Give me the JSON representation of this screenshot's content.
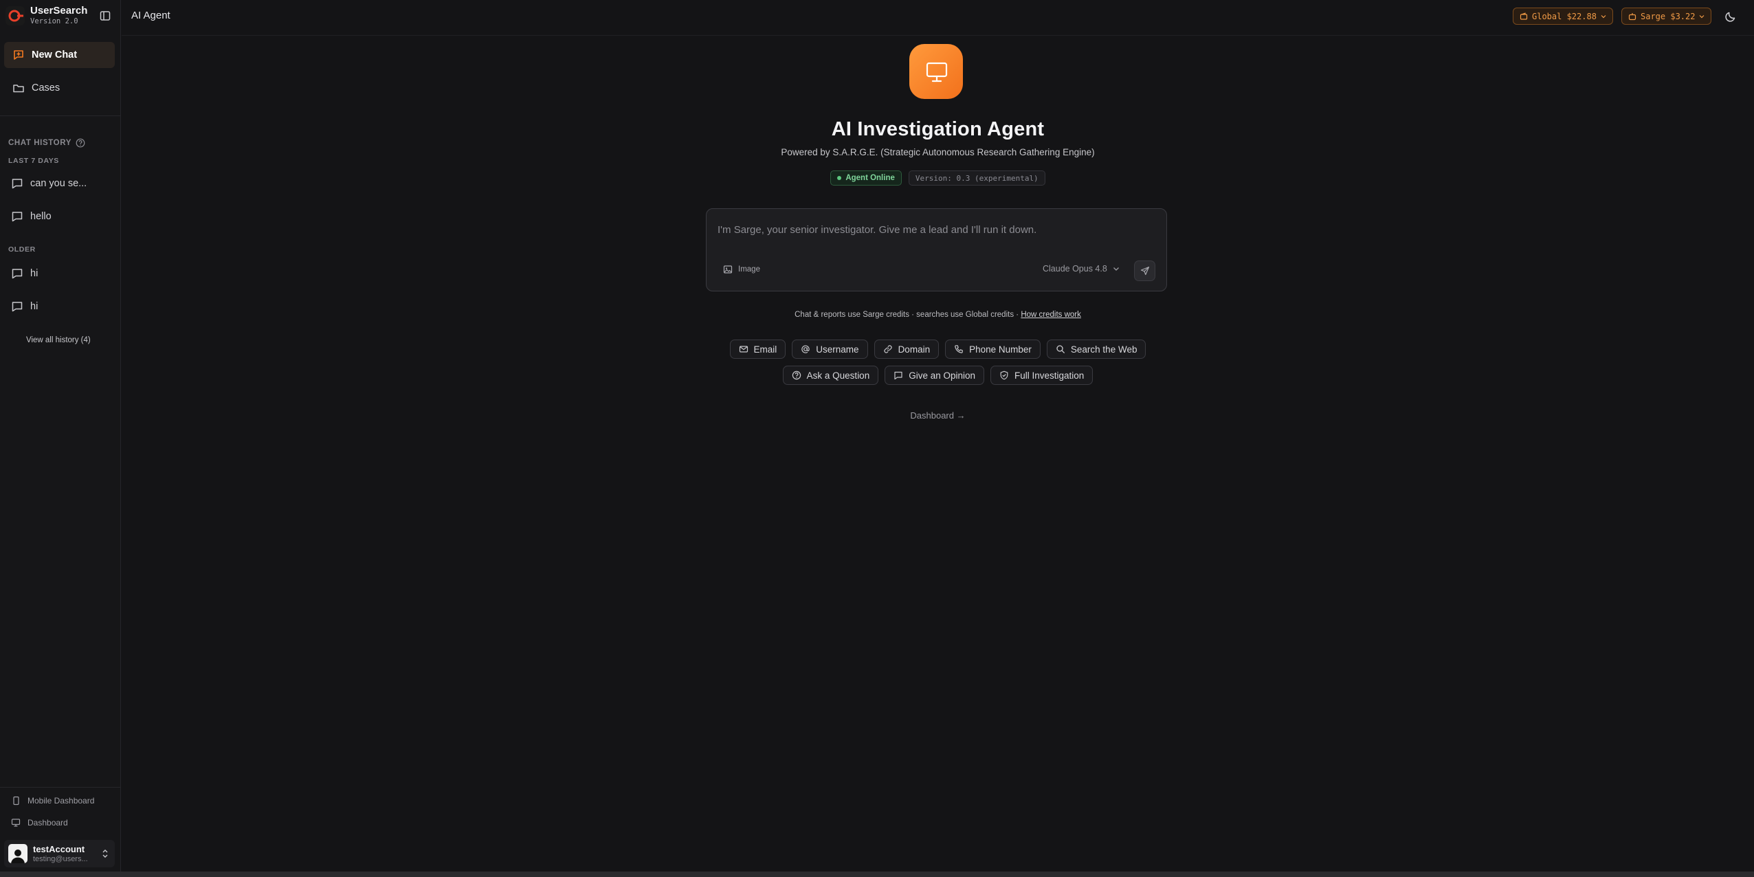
{
  "brand": {
    "name": "UserSearch",
    "version": "Version 2.0"
  },
  "sidebar": {
    "new_chat": "New Chat",
    "cases": "Cases",
    "history_label": "CHAT HISTORY",
    "group_recent": "LAST 7 DAYS",
    "group_older": "OLDER",
    "recent_chats": [
      "can you se...",
      "hello"
    ],
    "older_chats": [
      "hi",
      "hi"
    ],
    "view_all": "View all history (4)",
    "mobile_dashboard": "Mobile Dashboard",
    "dashboard": "Dashboard",
    "user": {
      "name": "testAccount",
      "email": "testing@users..."
    }
  },
  "topbar": {
    "page_label": "AI Agent",
    "global_credits": "Global $22.88",
    "sarge_credits": "Sarge $3.22"
  },
  "main": {
    "title": "AI Investigation Agent",
    "subtitle": "Powered by S.A.R.G.E. (Strategic Autonomous Research Gathering Engine)",
    "status": "Agent Online",
    "version": "Version: 0.3 (experimental)",
    "composer": {
      "placeholder": "I'm Sarge, your senior investigator. Give me a lead and I'll run it down.",
      "image_label": "Image",
      "model": "Claude Opus 4.8"
    },
    "credits_note": "Chat & reports use Sarge credits · searches use Global credits ·",
    "credits_link": "How credits work",
    "chips_row1": [
      "Email",
      "Username",
      "Domain",
      "Phone Number",
      "Search the Web"
    ],
    "chips_row2": [
      "Ask a Question",
      "Give an Opinion",
      "Full Investigation"
    ],
    "dashboard_link": "Dashboard →"
  },
  "colors": {
    "accent": "#f47a20",
    "online": "#5cc77f",
    "credit_text": "#f09a46"
  }
}
